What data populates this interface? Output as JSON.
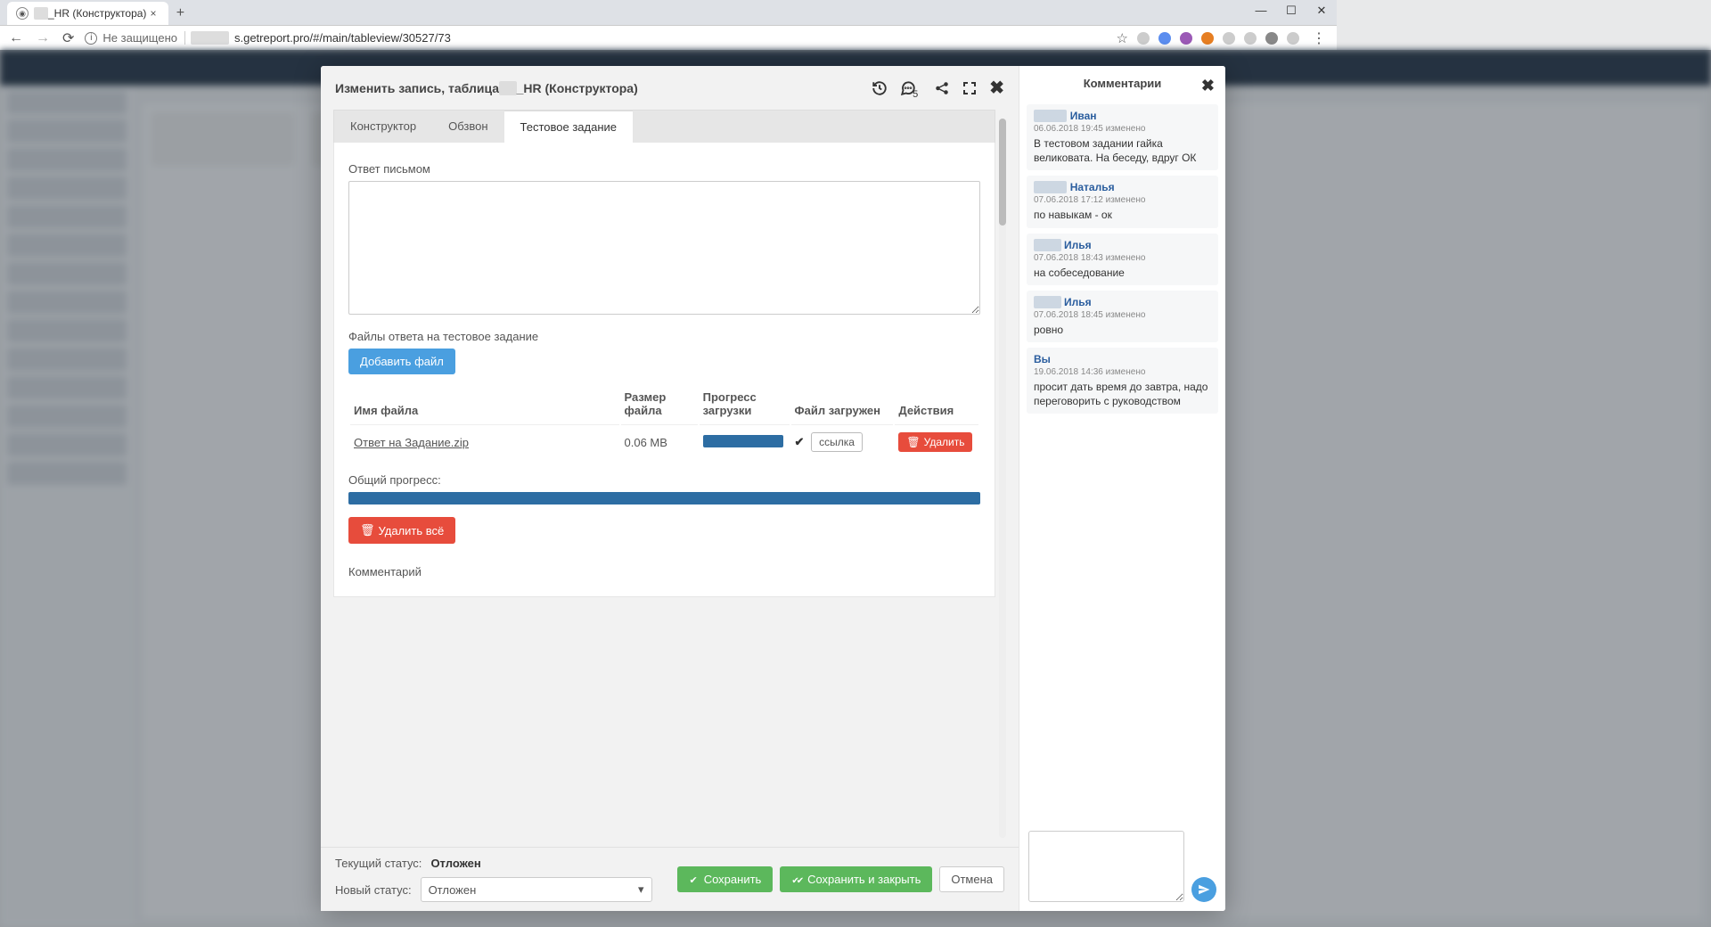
{
  "browser": {
    "tab_title": "_HR (Конструктора)",
    "security_label": "Не защищено",
    "url_visible": "s.getreport.pro/#/main/tableview/30527/73"
  },
  "modal": {
    "title_prefix": "Изменить запись, таблица",
    "title_suffix": "_HR (Конструктора)",
    "comment_count": "5",
    "tabs": [
      "Конструктор",
      "Обзвон",
      "Тестовое задание"
    ],
    "field_answer_label": "Ответ письмом",
    "field_files_label": "Файлы ответа на тестовое задание",
    "add_file_label": "Добавить файл",
    "table_headers": {
      "name": "Имя файла",
      "size": "Размер файла",
      "progress": "Прогресс загрузки",
      "uploaded": "Файл загружен",
      "actions": "Действия"
    },
    "file_row": {
      "name": "Ответ на Задание.zip",
      "size": "0.06 MB",
      "link_label": "ссылка",
      "delete_label": "Удалить"
    },
    "overall_progress_label": "Общий прогресс:",
    "delete_all_label": "Удалить всё",
    "comment_field_label": "Комментарий",
    "footer": {
      "current_status_label": "Текущий статус:",
      "current_status_value": "Отложен",
      "new_status_label": "Новый статус:",
      "new_status_value": "Отложен",
      "save_label": "Сохранить",
      "save_close_label": "Сохранить и закрыть",
      "cancel_label": "Отмена"
    }
  },
  "comments_panel": {
    "title": "Комментарии",
    "items": [
      {
        "author": "Иван",
        "meta": "06.06.2018 19:45  изменено",
        "text": "В тестовом задании гайка великовата. На беседу, вдруг ОК"
      },
      {
        "author": "Наталья",
        "meta": "07.06.2018 17:12  изменено",
        "text": "по навыкам - ок"
      },
      {
        "author": "Илья",
        "meta": "07.06.2018 18:43  изменено",
        "text": "на собеседование"
      },
      {
        "author": "Илья",
        "meta": "07.06.2018 18:45  изменено",
        "text": "ровно"
      },
      {
        "author": "Вы",
        "meta": "19.06.2018 14:36  изменено",
        "text": "просит дать время до завтра, надо переговорить с руководством"
      }
    ]
  }
}
